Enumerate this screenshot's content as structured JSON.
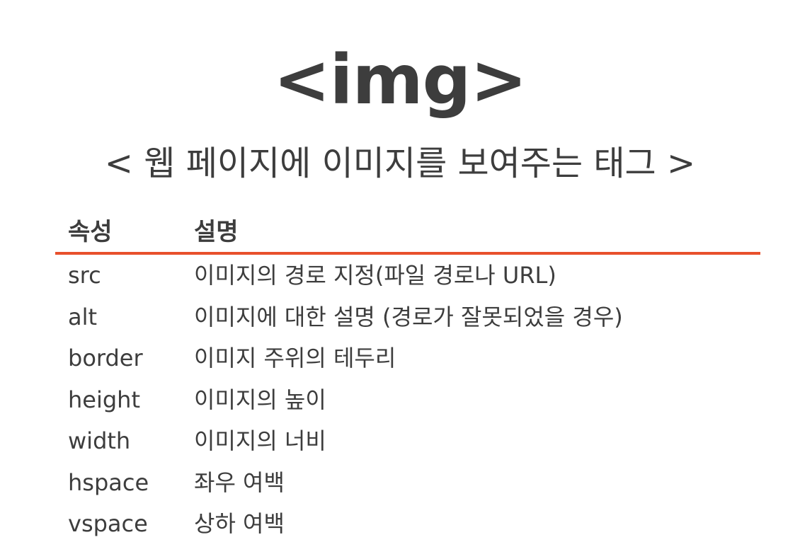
{
  "title": "<img>",
  "subtitle": "< 웹 페이지에 이미지를 보여주는 태그 >",
  "table": {
    "headers": {
      "attribute": "속성",
      "description": "설명"
    },
    "rows": [
      {
        "attribute": "src",
        "description": "이미지의 경로 지정(파일 경로나 URL)"
      },
      {
        "attribute": "alt",
        "description": "이미지에 대한 설명 (경로가 잘못되었을 경우)"
      },
      {
        "attribute": "border",
        "description": "이미지 주위의 테두리"
      },
      {
        "attribute": "height",
        "description": "이미지의 높이"
      },
      {
        "attribute": "width",
        "description": "이미지의 너비"
      },
      {
        "attribute": "hspace",
        "description": "좌우 여백"
      },
      {
        "attribute": "vspace",
        "description": "상하 여백"
      }
    ]
  },
  "colors": {
    "accent_rule": "#e8502c",
    "text": "#3d3d3d"
  }
}
